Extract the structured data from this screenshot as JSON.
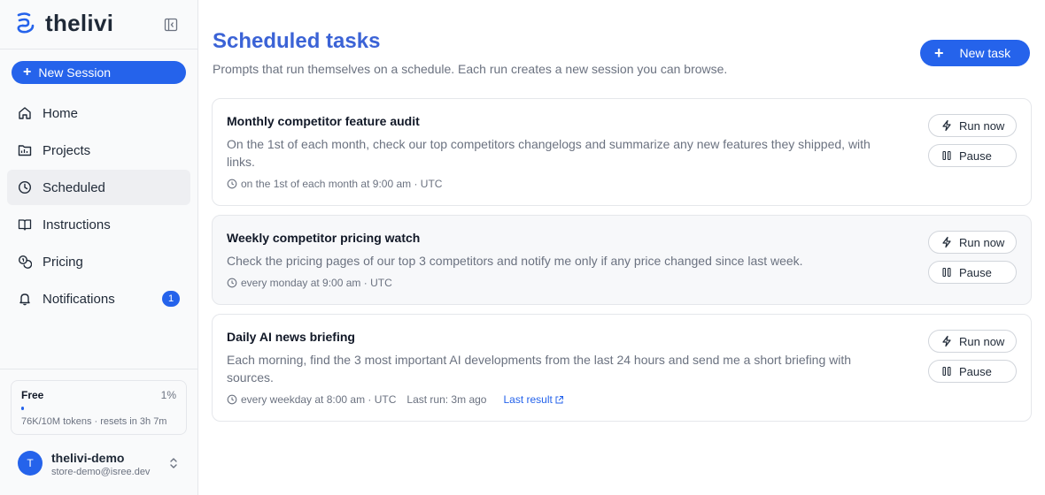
{
  "app": {
    "brand": "thelivi",
    "accent": "#2563eb"
  },
  "sidebar": {
    "new_session_label": "New Session",
    "items": [
      {
        "label": "Home",
        "icon": "home-icon"
      },
      {
        "label": "Projects",
        "icon": "folder-icon"
      },
      {
        "label": "Scheduled",
        "icon": "clock-icon",
        "active": true
      },
      {
        "label": "Instructions",
        "icon": "book-icon"
      },
      {
        "label": "Pricing",
        "icon": "coins-icon"
      },
      {
        "label": "Notifications",
        "icon": "bell-icon",
        "badge": "1"
      }
    ],
    "plan": {
      "name": "Free",
      "percent": "1%",
      "usage_fraction": 0.01,
      "usage_text": "76K/10M tokens · resets in 3h 7m"
    },
    "user": {
      "initial": "T",
      "name": "thelivi-demo",
      "email": "store-demo@isree.dev"
    }
  },
  "main": {
    "title": "Scheduled tasks",
    "subtitle": "Prompts that run themselves on a schedule. Each run creates a new session you can browse.",
    "new_task_label": "New task",
    "run_now_label": "Run now",
    "pause_label": "Pause",
    "tasks": [
      {
        "title": "Monthly competitor feature audit",
        "description": "On the 1st of each month, check our top competitors changelogs and summarize any new features they shipped, with links.",
        "schedule": "on the 1st of each month at 9:00 am · UTC"
      },
      {
        "title": "Weekly competitor pricing watch",
        "description": "Check the pricing pages of our top 3 competitors and notify me only if any price changed since last week.",
        "schedule": "every monday at 9:00 am · UTC"
      },
      {
        "title": "Daily AI news briefing",
        "description": "Each morning, find the 3 most important AI developments from the last 24 hours and send me a short briefing with sources.",
        "schedule": "every weekday at 8:00 am · UTC",
        "last_run": "Last run: 3m ago",
        "last_result_label": "Last result"
      }
    ]
  }
}
